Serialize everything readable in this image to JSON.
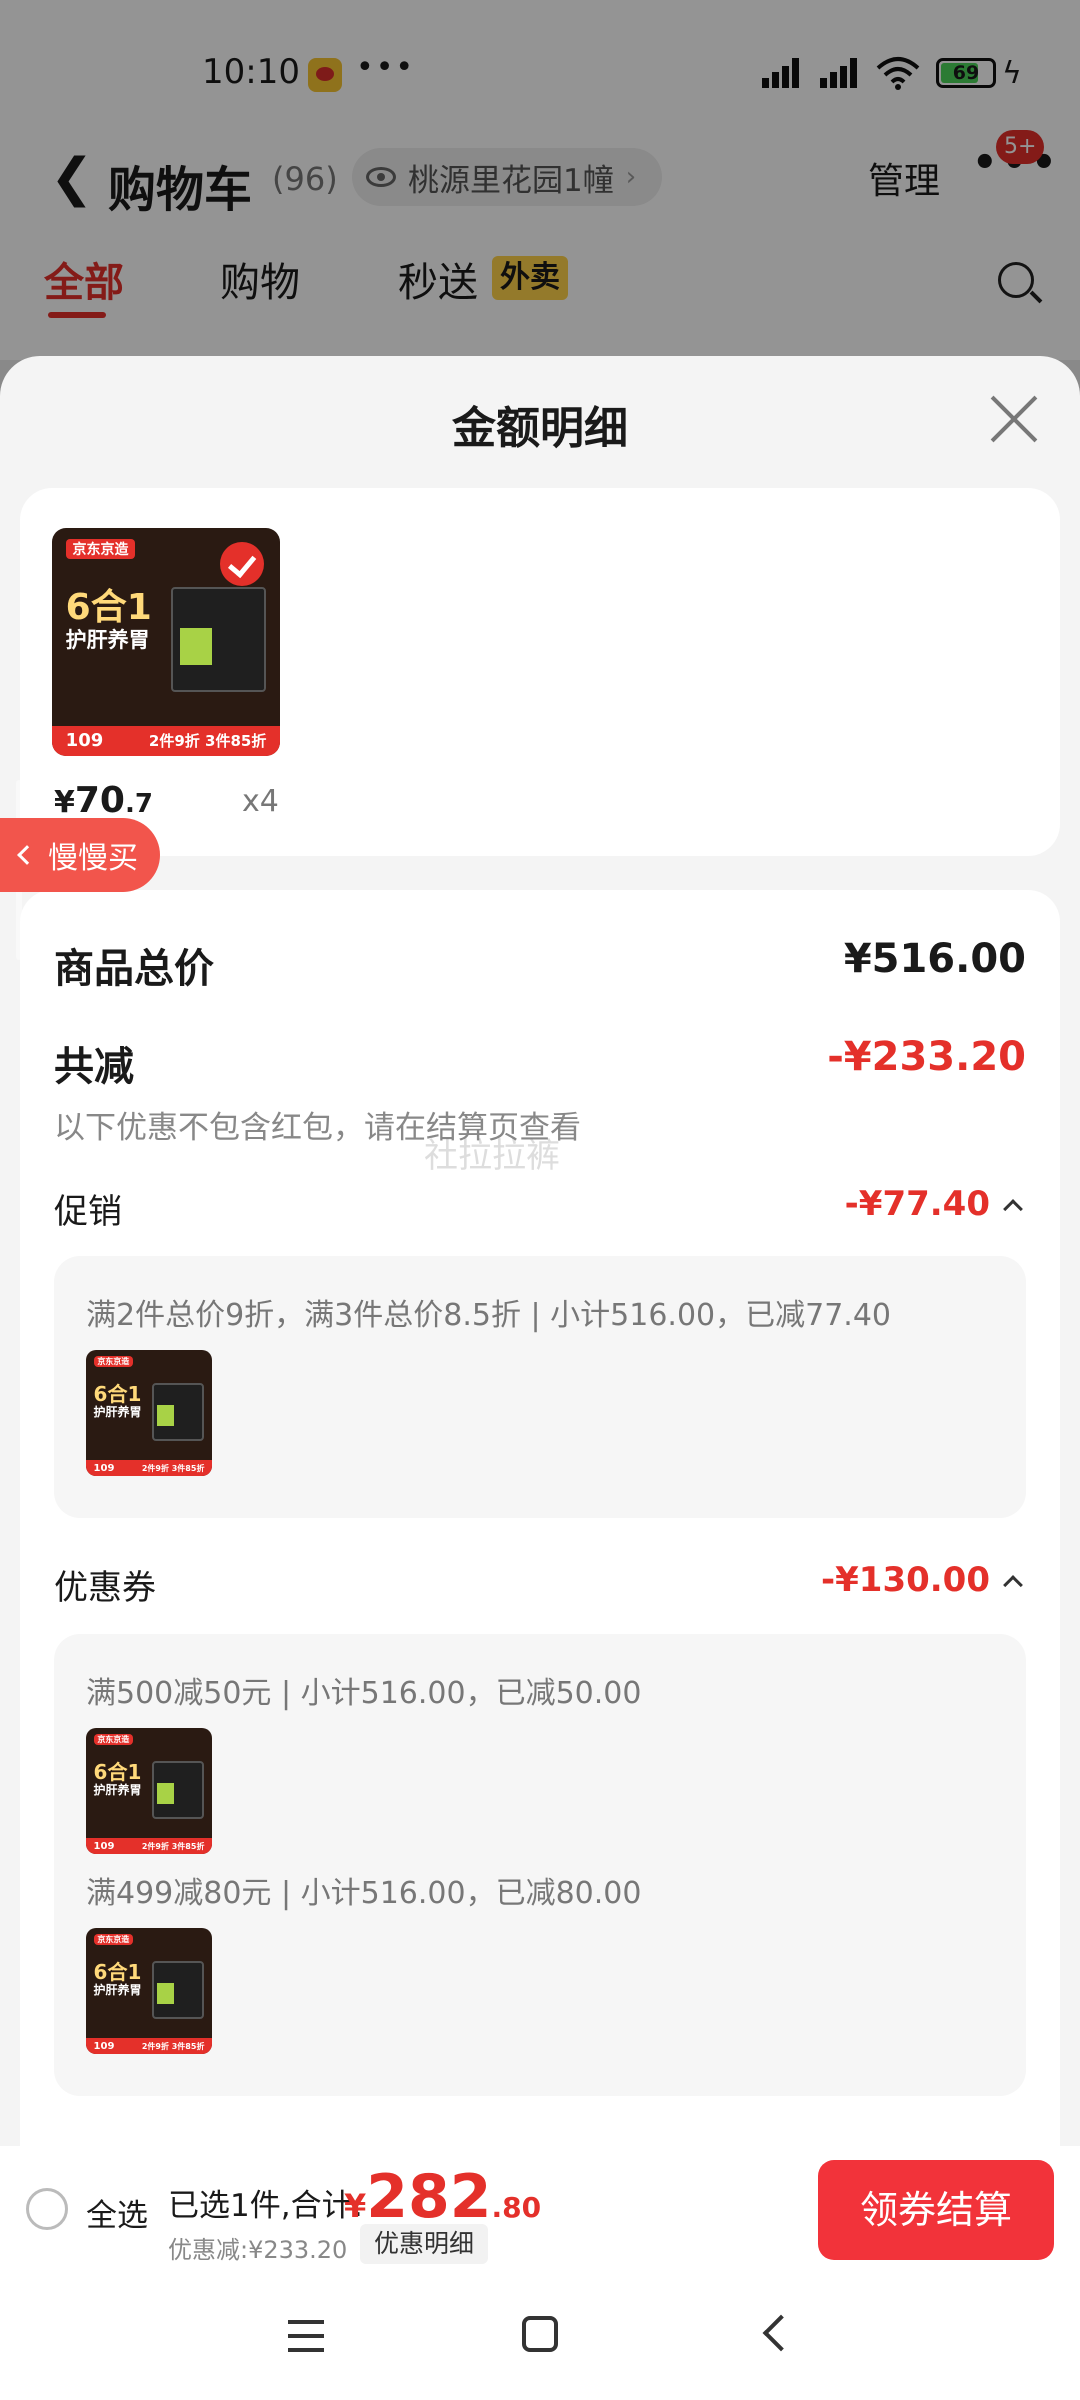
{
  "status_bar": {
    "time": "10:10",
    "battery": "69",
    "dots": "•••"
  },
  "cart_header": {
    "back": "❮",
    "title": "购物车",
    "count": "(96)",
    "address": "桃源里花园1幢",
    "address_chevron": "›",
    "manage": "管理",
    "more": "•••",
    "badge": "5+"
  },
  "tabs": [
    {
      "label": "全部",
      "active": true
    },
    {
      "label": "购物",
      "active": false
    },
    {
      "label": "秒送",
      "active": false
    }
  ],
  "takeout_tag": "外卖",
  "sheet": {
    "title": "金额明细",
    "product": {
      "thumb_brand": "京东京造",
      "thumb_title": "6合1",
      "thumb_subtitle": "护肝养胃",
      "thumb_price": "109",
      "thumb_promo": "2件9折 3件85折",
      "price_symbol": "¥",
      "price_int": "70",
      "price_dec": ".7",
      "quantity": "x4"
    },
    "summary": {
      "total_label": "商品总价",
      "total_value": "¥516.00",
      "reduce_label": "共减",
      "reduce_value": "-¥233.20",
      "reduce_note": "以下优惠不包含红包，请在结算页查看"
    },
    "promotion": {
      "label": "促销",
      "value": "-¥77.40",
      "detail": "满2件总价9折，满3件总价8.5折 | 小计516.00，已减77.40"
    },
    "coupon": {
      "label": "优惠券",
      "value": "-¥130.00",
      "items": [
        {
          "detail": "满500减50元 | 小计516.00，已减50.00"
        },
        {
          "detail": "满499减80元 | 小计516.00，已减80.00"
        }
      ]
    },
    "watermark": "社拉拉裤"
  },
  "float_button": {
    "label": "慢慢买"
  },
  "bottom_bar": {
    "select_all": "全选",
    "selected_text": "已选1件,合计:",
    "total_symbol": "¥",
    "total_int": "282",
    "total_dec": ".80",
    "discount_text": "优惠减:¥233.20",
    "detail_button": "优惠明细",
    "checkout_button": "领券结算"
  },
  "colors": {
    "accent": "#e4302a",
    "checkout": "#f2333a",
    "takeout": "#ffd24a"
  },
  "icons": [
    "weibo-icon",
    "signal-icon",
    "wifi-icon",
    "battery-icon",
    "eye-icon",
    "search-icon",
    "close-icon",
    "check-icon",
    "menu-icon",
    "home-icon",
    "back-icon"
  ]
}
